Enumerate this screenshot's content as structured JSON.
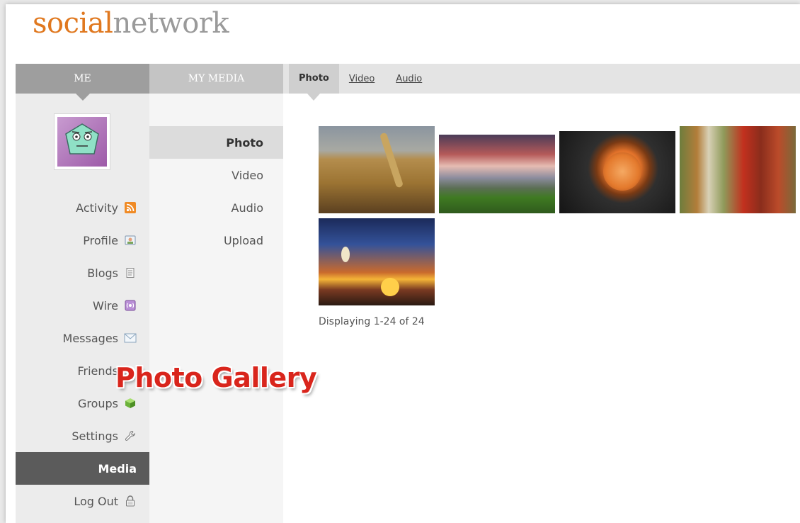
{
  "logo": {
    "part1": "social",
    "part2": "network"
  },
  "columns": {
    "me_header": "ME",
    "media_header": "MY MEDIA"
  },
  "nav": {
    "items": [
      {
        "label": "Activity",
        "icon": "rss-icon"
      },
      {
        "label": "Profile",
        "icon": "profile-card-icon"
      },
      {
        "label": "Blogs",
        "icon": "document-icon"
      },
      {
        "label": "Wire",
        "icon": "wire-icon"
      },
      {
        "label": "Messages",
        "icon": "envelope-icon"
      },
      {
        "label": "Friends",
        "icon": "friends-icon"
      },
      {
        "label": "Groups",
        "icon": "cube-icon"
      },
      {
        "label": "Settings",
        "icon": "wrench-icon"
      },
      {
        "label": "Media",
        "icon": ""
      },
      {
        "label": "Log Out",
        "icon": "lock-icon"
      }
    ],
    "active": "Media"
  },
  "media_nav": {
    "items": [
      "Photo",
      "Video",
      "Audio",
      "Upload"
    ],
    "active": "Photo"
  },
  "tabs": {
    "items": [
      "Photo",
      "Video",
      "Audio"
    ],
    "active": "Photo"
  },
  "gallery": {
    "photos": [
      "wheat",
      "seashore-sunset",
      "orange-rose",
      "autumn-forest",
      "palm-sunset"
    ],
    "display_text": "Displaying 1-24 of 24"
  },
  "overlay_caption": "Photo Gallery",
  "colors": {
    "logo_accent": "#e0781f",
    "logo_muted": "#9a9a9a",
    "active_nav": "#5b5b5b",
    "caption_red": "#d9251c"
  }
}
